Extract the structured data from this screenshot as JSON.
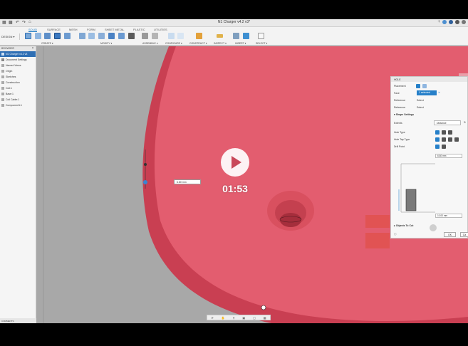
{
  "title_bar": {
    "document_title": "N1 Charger v4.2 v3*",
    "quick_access_icons": [
      "app-menu-icon",
      "save-icon",
      "undo-icon",
      "redo-icon",
      "home-icon"
    ],
    "window_icons": [
      "plus-icon",
      "globe-icon",
      "job-status-icon",
      "notification-icon",
      "help-icon"
    ]
  },
  "toolbar": {
    "workspace_label": "DESIGN ▾",
    "tabs": [
      "SOLID",
      "SURFACE",
      "MESH",
      "FORM",
      "SHEET METAL",
      "PLASTIC",
      "UTILITIES"
    ],
    "active_tab": "SOLID",
    "groups": [
      "CREATE ▾",
      "MODIFY ▾",
      "ASSEMBLE ▾",
      "CONFIGURE ▾",
      "CONSTRUCT ▾",
      "INSPECT ▾",
      "INSERT ▾",
      "SELECT ▾"
    ]
  },
  "browser": {
    "title": "BROWSER",
    "items": [
      {
        "label": "N1 Charger v4.2 v3",
        "selected": true
      },
      {
        "label": "Document Settings",
        "selected": false
      },
      {
        "label": "Named Views",
        "selected": false
      },
      {
        "label": "Origin",
        "selected": false
      },
      {
        "label": "Sketches",
        "selected": false
      },
      {
        "label": "Construction",
        "selected": false
      },
      {
        "label": "Coil:1",
        "selected": false
      },
      {
        "label": "Base:1",
        "selected": false
      },
      {
        "label": "Coil Cable:1",
        "selected": false
      },
      {
        "label": "Component1:1",
        "selected": false
      }
    ],
    "comments_label": "COMMENTS"
  },
  "viewport": {
    "dimension_value": "6.80 mm",
    "body_color": "#e35d6f",
    "background_color": "#a9a9a9"
  },
  "hole_dialog": {
    "title": "HOLE",
    "placement_label": "Placement",
    "face_label": "Face",
    "face_value": "1 selected",
    "reference1_label": "Reference",
    "reference1_value": "Select",
    "reference2_label": "Reference",
    "reference2_value": "Select",
    "shape_settings_label": "Shape Settings",
    "extents_label": "Extents",
    "extents_value": "Distance",
    "hole_type_label": "Hole Type",
    "hole_tap_type_label": "Hole Tap Type",
    "drill_point_label": "Drill Point",
    "diameter_value": "6.80 mm",
    "depth_value": "10.00 mm",
    "objects_to_cut_label": "Objects To Cut",
    "ok_label": "OK",
    "cancel_label": "Ca"
  },
  "video_overlay": {
    "duration": "01:53"
  }
}
